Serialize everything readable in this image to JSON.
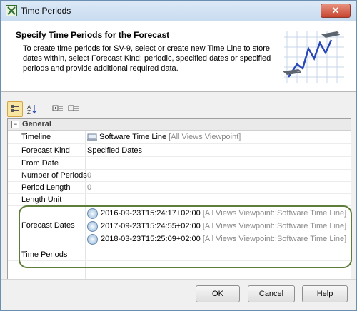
{
  "window": {
    "title": "Time Periods"
  },
  "header": {
    "heading": "Specify Time Periods for the Forecast",
    "description": "To create time periods for SV-9, select or create new Time Line to store dates within, select Forecast Kind: periodic, specified dates or specified periods and provide additional required data."
  },
  "grid": {
    "category": "General",
    "rows": {
      "timeline": {
        "label": "Timeline",
        "value": "Software Time Line",
        "context": "[All Views Viewpoint]"
      },
      "forecast_kind": {
        "label": "Forecast Kind",
        "value": "Specified Dates"
      },
      "from_date": {
        "label": "From Date",
        "value": ""
      },
      "number_of_periods": {
        "label": "Number of Periods",
        "value": "0"
      },
      "period_length": {
        "label": "Period Length",
        "value": "0"
      },
      "length_unit": {
        "label": "Length Unit",
        "value": ""
      },
      "forecast_dates": {
        "label": "Forecast Dates",
        "entries": [
          {
            "date": "2016-09-23T15:24:17+02:00",
            "context": "[All Views Viewpoint::Software Time Line]"
          },
          {
            "date": "2017-09-23T15:24:55+02:00",
            "context": "[All Views Viewpoint::Software Time Line]"
          },
          {
            "date": "2018-03-23T15:25:09+02:00",
            "context": "[All Views Viewpoint::Software Time Line]"
          }
        ]
      },
      "time_periods": {
        "label": "Time Periods",
        "value": ""
      }
    }
  },
  "buttons": {
    "ok": "OK",
    "cancel": "Cancel",
    "help": "Help"
  },
  "colors": {
    "highlight_border": "#5f7d3a",
    "title_close": "#c7452f"
  }
}
